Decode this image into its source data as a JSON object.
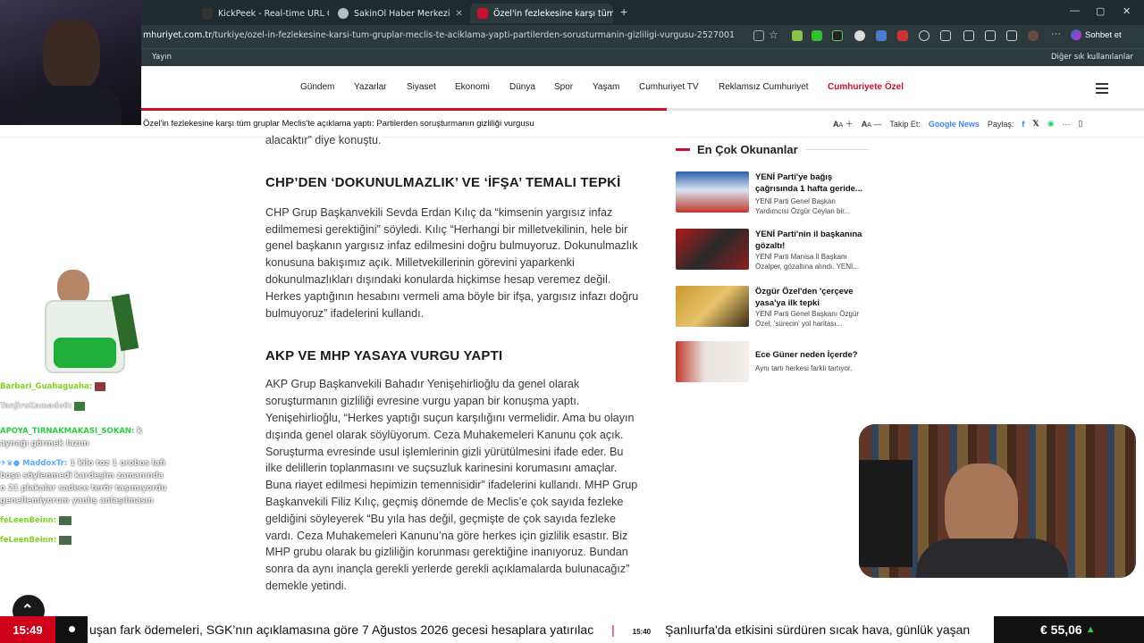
{
  "browser": {
    "tabs": [
      {
        "label": "KickPeek - Real-time URL Crawler"
      },
      {
        "label": "SakinOl Haber Merkezi"
      },
      {
        "label": "Özel'in fezlekesine karşı tüm grupl"
      }
    ],
    "url_host": "mhuriyet.com.tr",
    "url_path": "/turkiye/ozel-in-fezlekesine-karsi-tum-gruplar-meclis-te-aciklama-yapti-partilerden-sorusturmanin-gizliligi-vurgusu-2527001",
    "sohbet_label": "Sohbet et",
    "bookmark_left": "Yayın",
    "bookmark_right": "Diğer sık kullanılanlar"
  },
  "nav": {
    "items": [
      "Gündem",
      "Yazarlar",
      "Siyaset",
      "Ekonomi",
      "Dünya",
      "Spor",
      "Yaşam",
      "Cumhuriyet TV",
      "Reklamsız Cumhuriyet"
    ],
    "highlight": "Cumhuriyete Özel",
    "reading_progress": 0.583
  },
  "sticky": {
    "title": "Özel'in fezlekesine karşı tüm gruplar Meclis'te açıklama yaptı: Partilerden soruşturmanın gizliliği vurgusu",
    "font_small": "A",
    "font_large": "A",
    "follow_label": "Takip Et:",
    "gnews_label": "Google News",
    "share_label": "Paylaş:"
  },
  "article": {
    "top_line": "alacaktır” diye konuştu.",
    "heading1": "CHP’DEN ‘DOKUNULMAZLIK’ VE ‘İFŞA’ TEMALI TEPKİ",
    "para1": [
      "CHP Grup Başkanvekili Sevda Erdan Kılıç da “kimsenin yargısız infaz",
      "edilmemesi gerektiğini” söyledi. Kılıç “Herhangi bir milletvekilinin, hele bir",
      "genel başkanın yargısız infaz edilmesini doğru bulmuyoruz. Dokunulmazlık",
      "konusuna bakışımız açık. Milletvekillerinin görevini yaparkenki",
      "dokunulmazlıkları dışındaki konularda hiçkimse hesap veremez değil.",
      "Herkes yaptığının hesabını vermeli ama böyle bir ifşa, yargısız infazı doğru",
      "bulmuyoruz” ifadelerini kullandı."
    ],
    "heading2": "AKP VE MHP YASAYA VURGU YAPTI",
    "para2": [
      "AKP Grup Başkanvekili Bahadır Yenişehirlioğlu da genel olarak",
      "soruşturmanın gizliliği evresine vurgu yapan bir konuşma yaptı.",
      "Yenişehirlioğlu, “Herkes yaptığı suçun karşılığını vermelidir. Ama bu olayın",
      "dışında genel olarak söylüyorum. Ceza Muhakemeleri Kanunu çok açık.",
      "Soruşturma evresinde usul işlemlerinin gizli yürütülmesini ifade eder. Bu",
      "ilke delillerin toplanmasını ve suçsuzluk karinesini korumasını amaçlar.",
      "Buna riayet edilmesi hepimizin temennisidir” ifadelerini kullandı. MHP Grup",
      "Başkanvekili Filiz Kılıç, geçmiş dönemde de Meclis’e çok sayıda fezleke",
      "geldiğini söyleyerek “Bu yıla has değil, geçmişte de çok sayıda fezleke",
      "vardı. Ceza Muhakemeleri Kanunu’na göre herkes için gizlilik esastır. Biz",
      "MHP grubu olarak bu gizliliğin korunması gerektiğine inanıyoruz. Bundan",
      "sonra da aynı inançla gerekli yerlerde gerekli açıklamalarda bulunacağız”",
      "demekle yetindi."
    ]
  },
  "sidebar": {
    "title": "En Çok Okunanlar",
    "cards": [
      {
        "title": "YENİ Parti'ye bağış çağrısında 1 hafta geride...",
        "desc": "YENİ Parti Genel Başkan Yardımcısı Özgür Ceylan bir..."
      },
      {
        "title": "YENİ Parti'nin il başkanına gözaltı!",
        "desc": "YENİ Parti Manisa İl Başkanı Özalper, gözaltına alındı. YENİ..."
      },
      {
        "title": "Özgür Özel'den 'çerçeve yasa'ya ilk tepki",
        "desc": "YENİ Parti Genel Başkanı Özgür Özel, 'sürecin' yol haritası..."
      },
      {
        "title": "Ece Güner neden İçerde?",
        "desc": "Aynı tartı herkesi farklı tartıyor."
      }
    ]
  },
  "chat": [
    {
      "user": "Barbari_Guahaguaha:",
      "msg": "",
      "color": "#7ed321"
    },
    {
      "user": "TanjiroKamado0:",
      "msg": "",
      "color": "#e8e8e8"
    },
    {
      "user": "APOYA_TIRNAKMAKASI_SOKAN:",
      "msg": "k aynağı görmek lazım",
      "color": "#39d353"
    },
    {
      "user": "MaddoxTr:",
      "msg": "1 kilo toz 1 orobos lafı boşa söylenmedi kardeşim zamanında o 21 plakalar sadece terör taşımıyordu genellemiyorum yanlış anlaşılmasın",
      "color": "#5aa9ff"
    },
    {
      "user": "feLeenBeinn:",
      "msg": "",
      "color": "#7ed321"
    },
    {
      "user": "feLeenBeinn:",
      "msg": "",
      "color": "#7ed321"
    }
  ],
  "ticker": {
    "clock": "15:49",
    "text1": "uşan fark ödemeleri, SGK’nın açıklamasına göre 7 Ağustos 2026 gecesi hesaplara yatırılac",
    "time2": "15:40",
    "text2": "Şanlıurfa'da etkisini sürdüren sıcak hava, günlük yaşan",
    "currency": "€ 55,06"
  },
  "colors": {
    "accent": "#c8102e",
    "chrome": "#1f2b2e"
  }
}
